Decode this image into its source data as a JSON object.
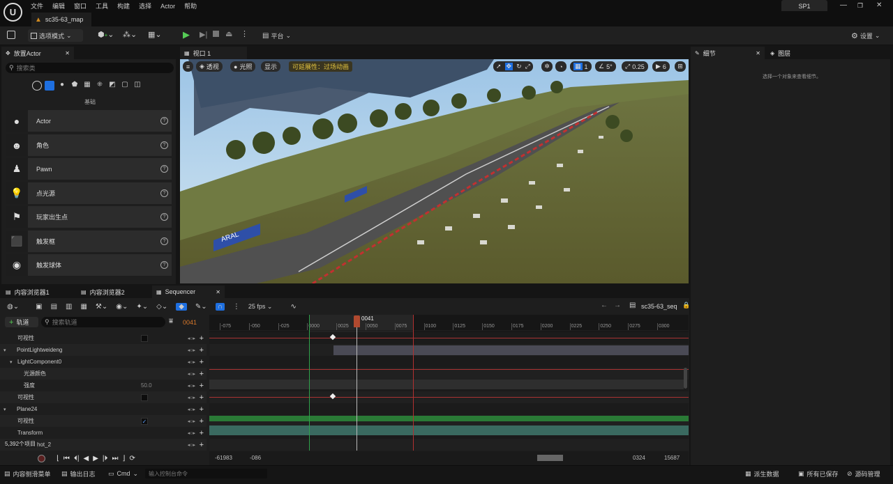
{
  "menubar": {
    "items": [
      "文件",
      "编辑",
      "窗口",
      "工具",
      "构建",
      "选择",
      "Actor",
      "帮助"
    ],
    "right_label": "SP1"
  },
  "document_tab": {
    "label": "sc35-63_map"
  },
  "toolbar": {
    "mode_label": "选项模式",
    "platform_label": "平台",
    "settings_label": "设置"
  },
  "place_actors": {
    "tab_label": "放置Actor",
    "search_placeholder": "搜索类",
    "category_label": "基础",
    "items": [
      {
        "label": "Actor",
        "icon": "sphere-icon"
      },
      {
        "label": "角色",
        "icon": "character-icon"
      },
      {
        "label": "Pawn",
        "icon": "pawn-icon"
      },
      {
        "label": "点光源",
        "icon": "lightbulb-icon"
      },
      {
        "label": "玩家出生点",
        "icon": "flag-icon"
      },
      {
        "label": "触发框",
        "icon": "box-trigger-icon"
      },
      {
        "label": "触发球体",
        "icon": "sphere-trigger-icon"
      }
    ]
  },
  "viewport": {
    "tab_label": "视口 1",
    "perspective_label": "透视",
    "lighting_label": "光照",
    "show_label": "显示",
    "visibility_label": "可延展性：过场动画",
    "grid_value": "1",
    "angle_value": "5°",
    "scale_value": "0.25",
    "camera_speed": "6",
    "sign_text": "ARAL"
  },
  "details": {
    "tab_label": "细节",
    "layers_label": "图层",
    "empty_message": "选择一个对象来查看细节。"
  },
  "bottom_tabs": {
    "content_browser_1": "内容浏览器1",
    "content_browser_2": "内容浏览器2",
    "sequencer": "Sequencer"
  },
  "sequencer": {
    "fps_label": "25 fps",
    "sequence_name": "sc35-63_seq",
    "add_track_label": "轨道",
    "search_placeholder": "搜索轨道",
    "current_frame": "0041",
    "playhead_label": "0041",
    "ruler_ticks": [
      "-075",
      "-050",
      "-025",
      "0000",
      "0025",
      "0050",
      "0075",
      "0100",
      "0125",
      "0150",
      "0175",
      "0200",
      "0225",
      "0250",
      "0275",
      "0300"
    ],
    "tracks": [
      {
        "label": "可视性",
        "indent": 1,
        "value": "",
        "has_checkbox": true,
        "checked": false
      },
      {
        "label": "PointLightweideng",
        "indent": 0,
        "value": "",
        "has_checkbox": false
      },
      {
        "label": "LightComponent0",
        "indent": 1,
        "value": "",
        "has_checkbox": false
      },
      {
        "label": "光源颜色",
        "indent": 2,
        "value": "",
        "has_checkbox": false
      },
      {
        "label": "强度",
        "indent": 2,
        "value": "50.0",
        "has_checkbox": false
      },
      {
        "label": "可视性",
        "indent": 1,
        "value": "",
        "has_checkbox": true,
        "checked": false
      },
      {
        "label": "Plane24",
        "indent": 0,
        "value": "",
        "has_checkbox": false
      },
      {
        "label": "可视性",
        "indent": 1,
        "value": "",
        "has_checkbox": true,
        "checked": true
      },
      {
        "label": "Transform",
        "indent": 1,
        "value": "",
        "has_checkbox": false
      },
      {
        "label": "ak_BP_hot_2",
        "indent": 1,
        "value": "",
        "has_checkbox": false
      }
    ],
    "item_count": "5,392个项目",
    "range_start": "-61983",
    "range_view_start": "-086",
    "range_view_end": "0324",
    "range_end": "15687"
  },
  "statusbar": {
    "content_drawer": "内容侧滑菜单",
    "output_log": "输出日志",
    "cmd_label": "Cmd",
    "cmd_placeholder": "输入控制台命令",
    "derived_data": "派生数据",
    "all_saved": "所有已保存",
    "source_control": "源码管理"
  }
}
